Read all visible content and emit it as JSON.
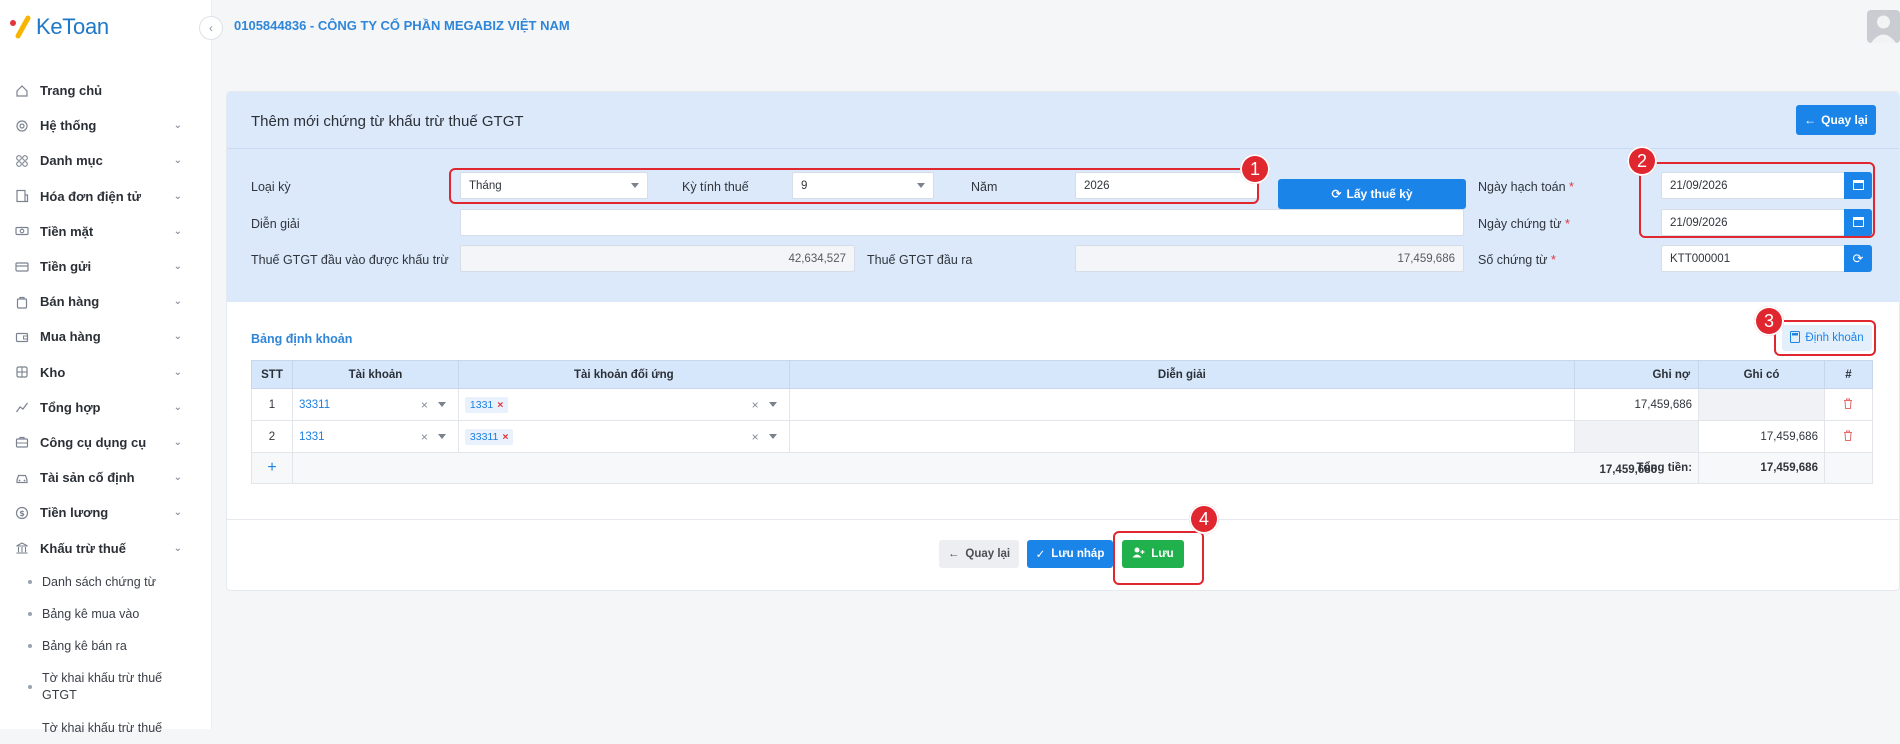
{
  "app": {
    "brand": "KeToan",
    "company": "0105844836 - CÔNG TY CỔ PHẦN MEGABIZ VIỆT NAM"
  },
  "sidebar": {
    "items": [
      {
        "label": "Trang chủ",
        "icon": "home-icon",
        "chevron": false
      },
      {
        "label": "Hệ thống",
        "icon": "gear-icon",
        "chevron": true
      },
      {
        "label": "Danh mục",
        "icon": "grid-icon",
        "chevron": true
      },
      {
        "label": "Hóa đơn điện tử",
        "icon": "invoice-icon",
        "chevron": true
      },
      {
        "label": "Tiền mặt",
        "icon": "cash-icon",
        "chevron": true
      },
      {
        "label": "Tiền gửi",
        "icon": "card-icon",
        "chevron": true
      },
      {
        "label": "Bán hàng",
        "icon": "bag-icon",
        "chevron": true
      },
      {
        "label": "Mua hàng",
        "icon": "wallet-icon",
        "chevron": true
      },
      {
        "label": "Kho",
        "icon": "warehouse-icon",
        "chevron": true
      },
      {
        "label": "Tổng hợp",
        "icon": "chart-icon",
        "chevron": true
      },
      {
        "label": "Công cụ dụng cụ",
        "icon": "tools-icon",
        "chevron": true
      },
      {
        "label": "Tài sản cố định",
        "icon": "car-icon",
        "chevron": true
      },
      {
        "label": "Tiền lương",
        "icon": "dollar-icon",
        "chevron": true
      },
      {
        "label": "Khấu trừ thuế",
        "icon": "bank-icon",
        "chevron": true
      }
    ],
    "subitems": [
      "Danh sách chứng từ",
      "Bảng kê mua vào",
      "Bảng kê bán ra",
      "Tờ khai khấu trừ thuế GTGT",
      "Tờ khai khấu trừ thuế"
    ]
  },
  "page": {
    "title": "Thêm mới chứng từ khấu trừ thuế GTGT",
    "back_label": "Quay lại"
  },
  "form": {
    "period_type_label": "Loại kỳ",
    "period_type_value": "Tháng",
    "tax_period_label": "Kỳ tính thuế",
    "tax_period_value": "9",
    "year_label": "Năm",
    "year_value": "2026",
    "get_tax_label": "Lấy thuế kỳ",
    "posting_date_label": "Ngày hạch toán",
    "posting_date_value": "21/09/2026",
    "description_label": "Diễn giải",
    "description_value": "",
    "voucher_date_label": "Ngày chứng từ",
    "voucher_date_value": "21/09/2026",
    "input_vat_label": "Thuế GTGT đầu vào được khấu trừ",
    "input_vat_value": "42,634,527",
    "output_vat_label": "Thuế GTGT đầu ra",
    "output_vat_value": "17,459,686",
    "voucher_no_label": "Số chứng từ",
    "voucher_no_value": "KTT000001",
    "required_mark": "*"
  },
  "entries": {
    "section_title": "Bảng định khoản",
    "button_label": "Định khoản",
    "headers": [
      "STT",
      "Tài khoản",
      "Tài khoản đối ứng",
      "Diễn giải",
      "Ghi nợ",
      "Ghi có",
      "#"
    ],
    "rows": [
      {
        "stt": "1",
        "account": "33311",
        "contra": "1331",
        "desc": "",
        "debit": "17,459,686",
        "credit": ""
      },
      {
        "stt": "2",
        "account": "1331",
        "contra": "33311",
        "desc": "",
        "debit": "",
        "credit": "17,459,686"
      }
    ],
    "add_label": "+",
    "total_label": "Tổng tiền:",
    "total_debit": "17,459,686",
    "total_credit": "17,459,686"
  },
  "footer": {
    "back_label": "Quay lại",
    "draft_label": "Lưu nháp",
    "save_label": "Lưu"
  },
  "annotations": [
    "1",
    "2",
    "3",
    "4"
  ],
  "colors": {
    "primary": "#1b84e8",
    "success": "#21b14c",
    "highlight": "#e0262e",
    "header_bg": "#dbe9fb"
  }
}
